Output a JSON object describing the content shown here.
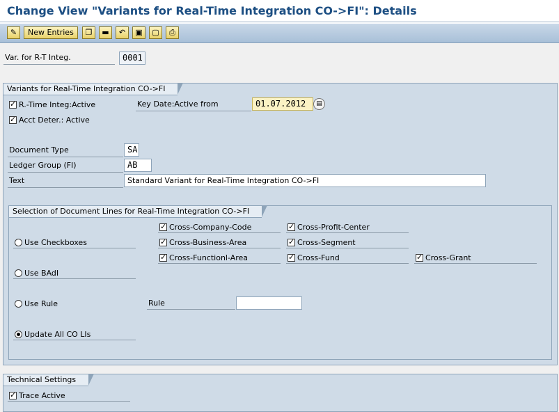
{
  "title": "Change View \"Variants for Real-Time Integration CO->FI\": Details",
  "toolbar": {
    "new_entries": "New Entries",
    "icons": [
      "edit-icon",
      "copy-icon",
      "delete-icon",
      "undo-icon",
      "select-all-icon",
      "deselect-all-icon",
      "print-icon"
    ]
  },
  "header": {
    "variant_label": "Var. for R-T Integ.",
    "variant_value": "0001"
  },
  "group1": {
    "title": "Variants for Real-Time Integration CO->FI",
    "rt_active_label": "R.-Time Integ:Active",
    "rt_active": true,
    "key_date_label": "Key Date:Active from",
    "key_date_value": "01.07.2012",
    "acct_deter_label": "Acct Deter.: Active",
    "acct_deter": true,
    "doc_type_label": "Document Type",
    "doc_type_value": "SA",
    "ledger_group_label": "Ledger Group (FI)",
    "ledger_group_value": "AB",
    "text_label": "Text",
    "text_value": "Standard Variant for Real-Time Integration CO->FI"
  },
  "selection": {
    "title": "Selection of Document Lines for Real-Time Integration CO->FI",
    "use_checkboxes": "Use Checkboxes",
    "use_badi": "Use BAdI",
    "use_rule": "Use Rule",
    "rule_label": "Rule",
    "rule_value": "",
    "update_all": "Update All CO LIs",
    "selected_option": "Update All CO LIs",
    "cross_company_code": "Cross-Company-Code",
    "cross_profit_center": "Cross-Profit-Center",
    "cross_business_area": "Cross-Business-Area",
    "cross_segment": "Cross-Segment",
    "cross_functional_area": "Cross-Functionl-Area",
    "cross_fund": "Cross-Fund",
    "cross_grant": "Cross-Grant"
  },
  "technical": {
    "title": "Technical Settings",
    "trace_label": "Trace Active",
    "trace": true
  }
}
